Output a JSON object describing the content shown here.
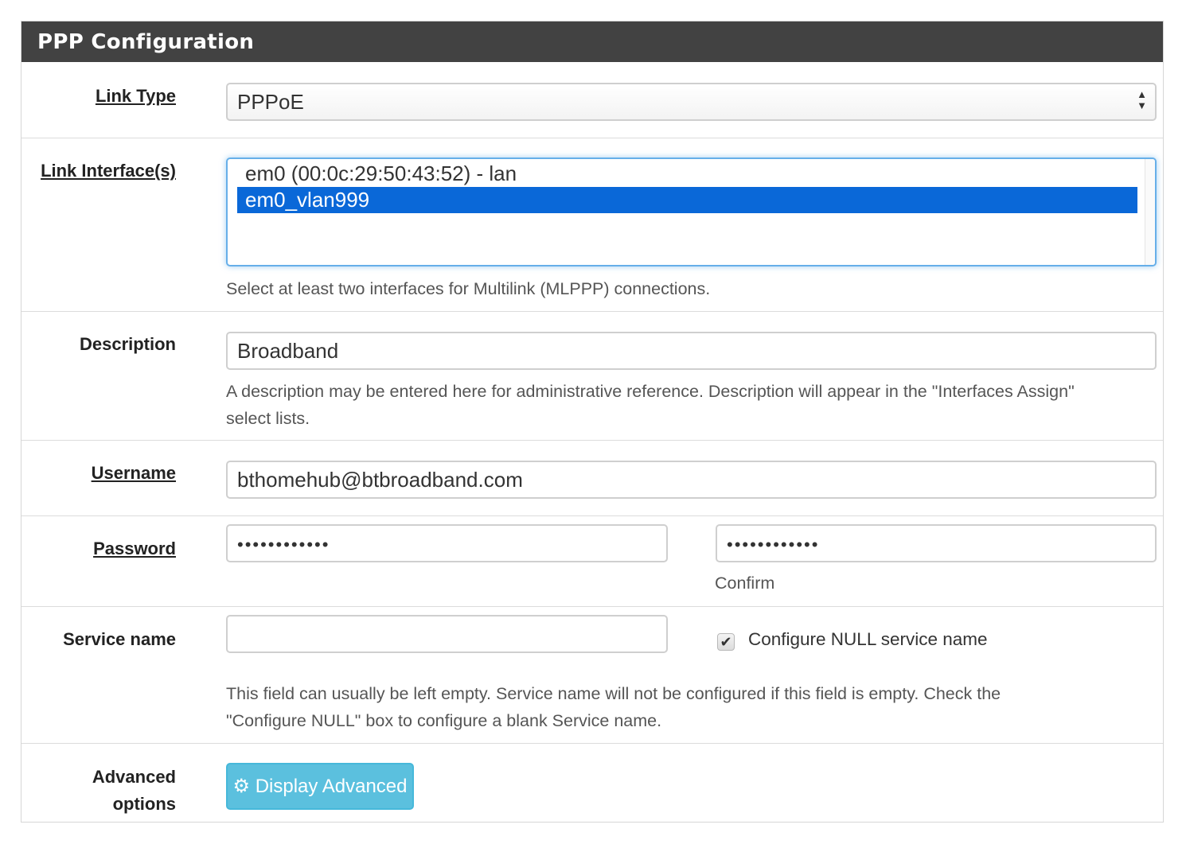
{
  "panel": {
    "title": "PPP Configuration"
  },
  "link_type": {
    "label": "Link Type",
    "value": "PPPoE"
  },
  "link_interfaces": {
    "label": "Link Interface(s)",
    "options": [
      {
        "text": "em0 (00:0c:29:50:43:52) - lan",
        "selected": false
      },
      {
        "text": "em0_vlan999",
        "selected": true
      }
    ],
    "help": "Select at least two interfaces for Multilink (MLPPP) connections."
  },
  "description": {
    "label": "Description",
    "value": "Broadband",
    "help_line1": "A description may be entered here for administrative reference. Description will appear in the \"Interfaces Assign\"",
    "help_line2": "select lists."
  },
  "username": {
    "label": "Username",
    "value": "bthomehub@btbroadband.com"
  },
  "password": {
    "label": "Password",
    "value": "••••••••••••",
    "confirm_value": "••••••••••••",
    "confirm_label": "Confirm"
  },
  "service_name": {
    "label": "Service name",
    "value": "",
    "null_checkbox_label": "Configure NULL service name",
    "null_checked": true,
    "help_line1": "This field can usually be left empty. Service name will not be configured if this field is empty. Check the",
    "help_line2": "\"Configure NULL\" box to configure a blank Service name."
  },
  "advanced": {
    "label_line1": "Advanced",
    "label_line2": "options",
    "button_label": "Display Advanced",
    "button_icon": "gear-icon"
  },
  "colors": {
    "header_bg": "#424242",
    "selected_option": "#0a68d8",
    "info_button": "#5bc0de",
    "focus_border": "#66afe9"
  }
}
